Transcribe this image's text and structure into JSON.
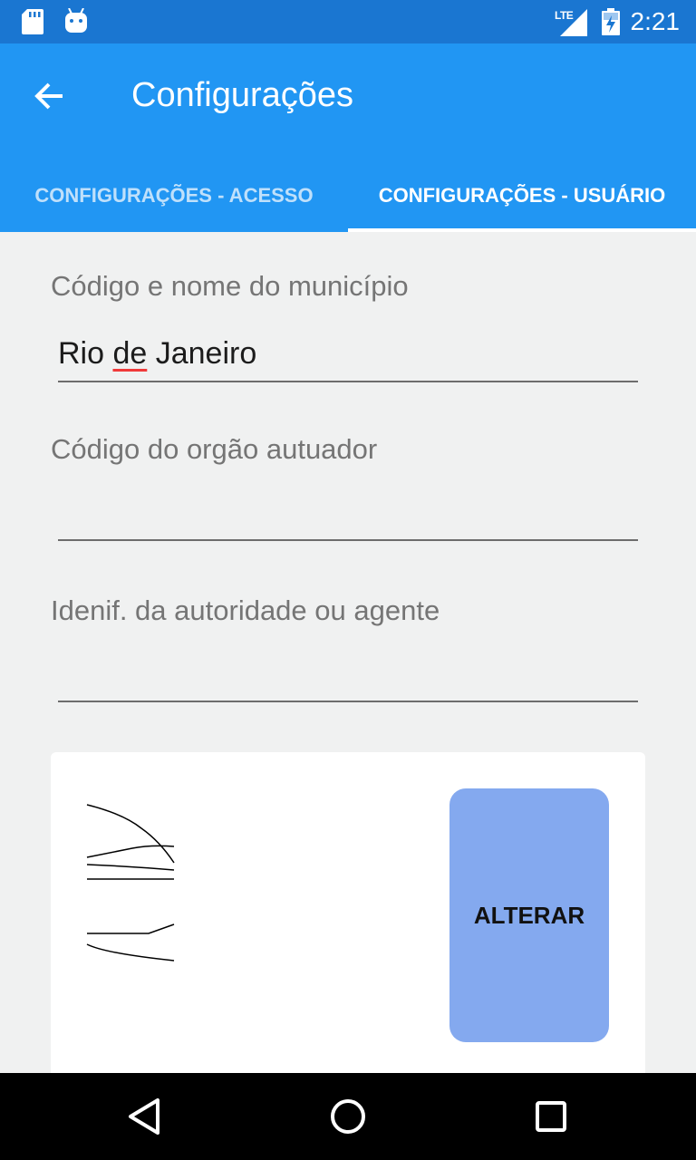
{
  "status_bar": {
    "time": "2:21",
    "network": "LTE",
    "icons": [
      "sd-card-icon",
      "android-icon",
      "signal-icon",
      "battery-icon"
    ]
  },
  "app_bar": {
    "title": "Configurações",
    "back_icon": "arrow-back-icon",
    "color": "#2196f3"
  },
  "tabs": [
    {
      "label": "CONFIGURAÇÕES - ACESSO",
      "selected": false
    },
    {
      "label": "CONFIGURAÇÕES - USUÁRIO",
      "selected": true
    }
  ],
  "form": {
    "municipio": {
      "label": "Código e nome do município",
      "value_prefix": "Rio ",
      "value_misspelled": "de",
      "value_suffix": " Janeiro"
    },
    "orgao": {
      "label": "Código do orgão autuador",
      "value": ""
    },
    "agente": {
      "label": "Idenif. da autoridade ou agente",
      "value": ""
    }
  },
  "signature": {
    "button_label": "ALTERAR",
    "button_color": "#84a9ef"
  },
  "nav_bar": {
    "icons": [
      "back-triangle-icon",
      "home-circle-icon",
      "recents-square-icon"
    ]
  }
}
